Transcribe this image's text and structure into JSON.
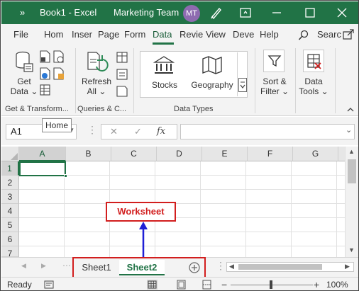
{
  "titlebar": {
    "more_glyph": "»",
    "title": "Book1  -  Excel",
    "team": "Marketing Team",
    "avatar_initials": "MT"
  },
  "tabs": [
    "File",
    "Hom",
    "Inser",
    "Page",
    "Form",
    "Data",
    "Revie",
    "View",
    "Deve",
    "Help"
  ],
  "active_tab": "Data",
  "search_label": "Searc",
  "ribbon": {
    "get_data_label": [
      "Get",
      "Data"
    ],
    "refresh_label": [
      "Refresh",
      "All"
    ],
    "stocks_label": "Stocks",
    "geography_label": "Geography",
    "sort_filter_label": [
      "Sort &",
      "Filter"
    ],
    "data_tools_label": [
      "Data",
      "Tools"
    ],
    "groups": [
      "Get & Transform...",
      "Queries & C...",
      "Data Types"
    ]
  },
  "tooltip": "Home",
  "formula_bar": {
    "name_box": "A1",
    "cancel": "✕",
    "enter": "✓",
    "fx": "fx"
  },
  "columns": [
    "A",
    "B",
    "C",
    "D",
    "E",
    "F",
    "G"
  ],
  "rows": [
    "1",
    "2",
    "3",
    "4",
    "5",
    "6",
    "7"
  ],
  "selected_cell": "A1",
  "callout_text": "Worksheet",
  "sheets": [
    "Sheet1",
    "Sheet2"
  ],
  "active_sheet": "Sheet2",
  "status": {
    "ready": "Ready",
    "zoom": "100%"
  },
  "colors": {
    "excel_green": "#217346",
    "annotation_red": "#d21e1e",
    "arrow_blue": "#1f1fd6",
    "avatar_purple": "#8e6bb0"
  }
}
